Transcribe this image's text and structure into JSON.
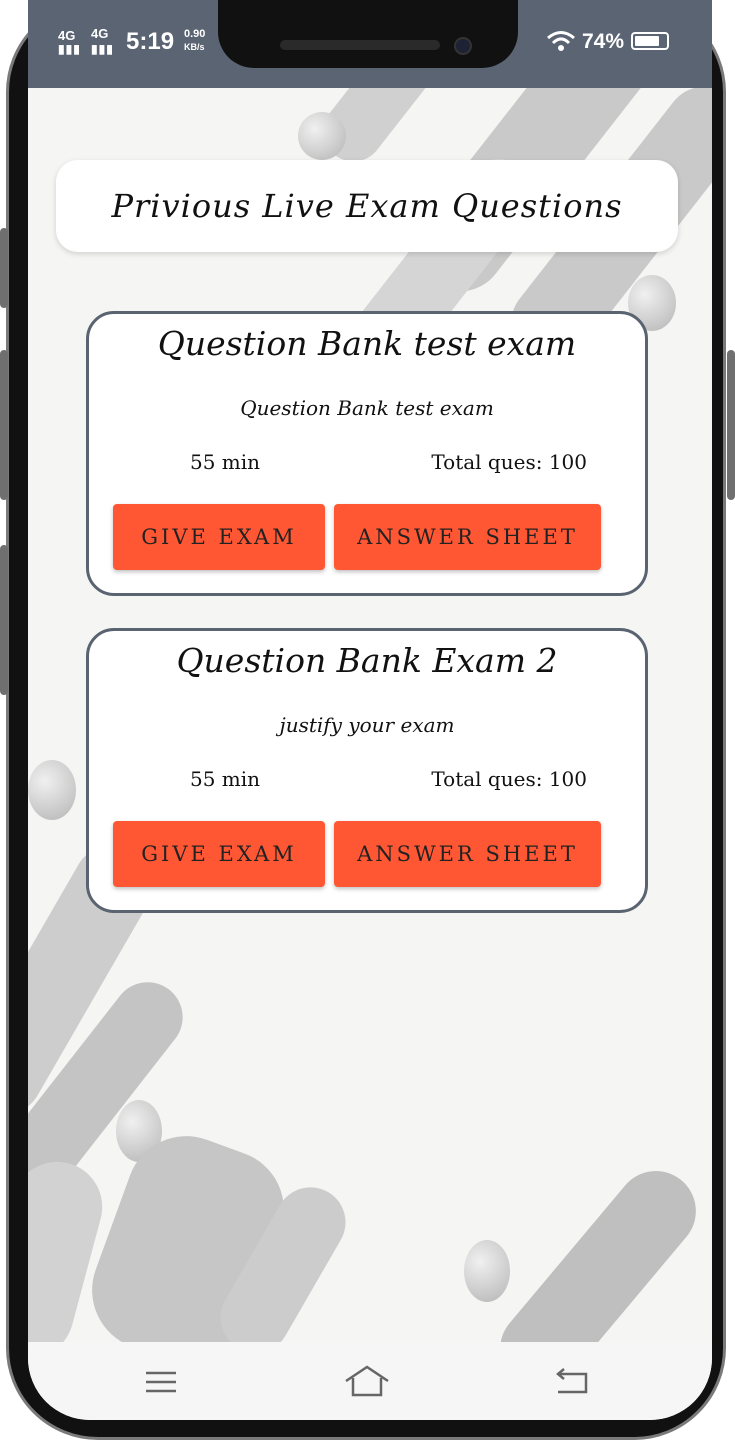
{
  "status_bar": {
    "network_1": "4G",
    "network_2": "4G",
    "time": "5:19",
    "speed_value": "0.90",
    "speed_unit": "KB/s",
    "battery": "74%"
  },
  "header": {
    "title": "Privious Live Exam Questions"
  },
  "exams": [
    {
      "title": "Question Bank test exam",
      "description": "Question Bank test exam",
      "duration": "55 min",
      "total": "Total ques: 100",
      "give_label": "GIVE EXAM",
      "answer_label": "ANSWER SHEET"
    },
    {
      "title": "Question Bank Exam 2",
      "description": "justify your exam",
      "duration": "55 min",
      "total": "Total ques: 100",
      "give_label": "GIVE EXAM",
      "answer_label": "ANSWER SHEET"
    }
  ],
  "nav": {
    "icons": [
      "menu-icon",
      "home-icon",
      "back-icon"
    ]
  },
  "colors": {
    "accent": "#ff5733",
    "status_bar": "#5b6472",
    "card_border": "#5a6370"
  }
}
